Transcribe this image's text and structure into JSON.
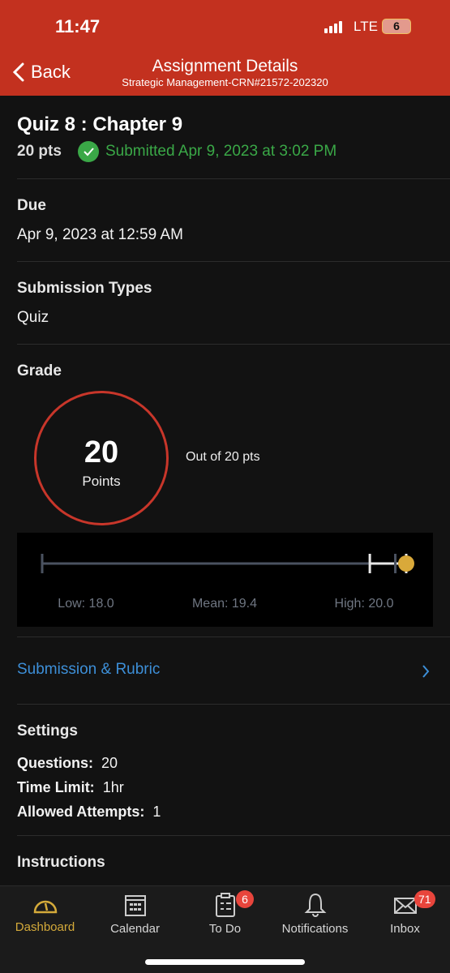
{
  "status_bar": {
    "time": "11:47",
    "network": "LTE",
    "battery": "6"
  },
  "nav": {
    "back_label": "Back",
    "title": "Assignment Details",
    "subtitle": "Strategic Management-CRN#21572-202320"
  },
  "assignment": {
    "title": "Quiz 8 : Chapter 9",
    "points": "20 pts",
    "status": "Submitted Apr 9, 2023 at 3:02 PM",
    "status_color": "#3aa847"
  },
  "due": {
    "label": "Due",
    "value": "Apr 9, 2023 at 12:59 AM"
  },
  "submission_types": {
    "label": "Submission Types",
    "value": "Quiz"
  },
  "grade": {
    "label": "Grade",
    "score": "20",
    "score_unit": "Points",
    "out_of": "Out of 20 pts",
    "ring_color": "#c8362a"
  },
  "chart_data": {
    "type": "box",
    "min": 0,
    "max": 20,
    "low": 18.0,
    "mean": 19.4,
    "high": 20.0,
    "score": 20,
    "labels": {
      "low": "Low: 18.0",
      "mean": "Mean: 19.4",
      "high": "High: 20.0"
    },
    "score_color": "#d9a93a"
  },
  "submission_rubric": {
    "label": "Submission & Rubric",
    "color": "#3d8fd8"
  },
  "settings": {
    "label": "Settings",
    "items": [
      {
        "key": "Questions:",
        "value": "20"
      },
      {
        "key": "Time Limit:",
        "value": "1hr"
      },
      {
        "key": "Allowed Attempts:",
        "value": "1"
      }
    ]
  },
  "instructions": {
    "label": "Instructions"
  },
  "tabs": [
    {
      "label": "Dashboard",
      "icon": "dashboard-icon",
      "active": true
    },
    {
      "label": "Calendar",
      "icon": "calendar-icon"
    },
    {
      "label": "To Do",
      "icon": "todo-icon",
      "badge": "6"
    },
    {
      "label": "Notifications",
      "icon": "bell-icon"
    },
    {
      "label": "Inbox",
      "icon": "envelope-icon",
      "badge": "71"
    }
  ],
  "accent": "#d4aa3a"
}
